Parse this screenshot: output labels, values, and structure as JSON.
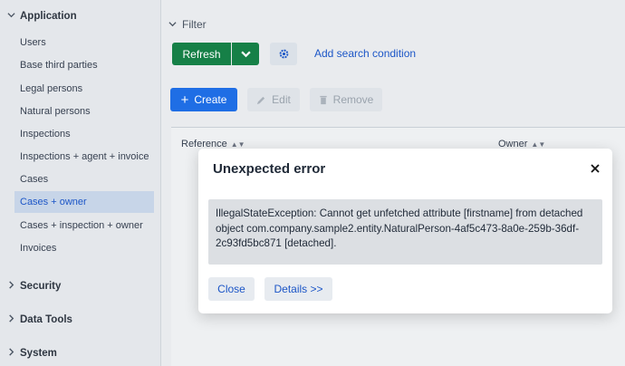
{
  "sidebar": {
    "application": {
      "label": "Application",
      "items": [
        "Users",
        "Base third parties",
        "Legal persons",
        "Natural persons",
        "Inspections",
        "Inspections + agent + invoice",
        "Cases",
        "Cases + owner",
        "Cases + inspection + owner",
        "Invoices"
      ]
    },
    "security_label": "Security",
    "datatools_label": "Data Tools",
    "system_label": "System"
  },
  "filter": {
    "label": "Filter",
    "refresh_label": "Refresh",
    "add_condition_label": "Add search condition"
  },
  "toolbar": {
    "create_label": "Create",
    "edit_label": "Edit",
    "remove_label": "Remove"
  },
  "table": {
    "columns": [
      "Reference",
      "Owner"
    ]
  },
  "dialog": {
    "title": "Unexpected error",
    "message": "IllegalStateException: Cannot get unfetched attribute [firstname] from detached object com.company.sample2.entity.NaturalPerson-4af5c473-8a0e-259b-36df-2c93fd5bc871 [detached].",
    "close_label": "Close",
    "details_label": "Details >>"
  },
  "colors": {
    "primary": "#1f6ee5",
    "success": "#168047",
    "link": "#1c56c7",
    "active_item_bg": "#c7d5e8"
  }
}
